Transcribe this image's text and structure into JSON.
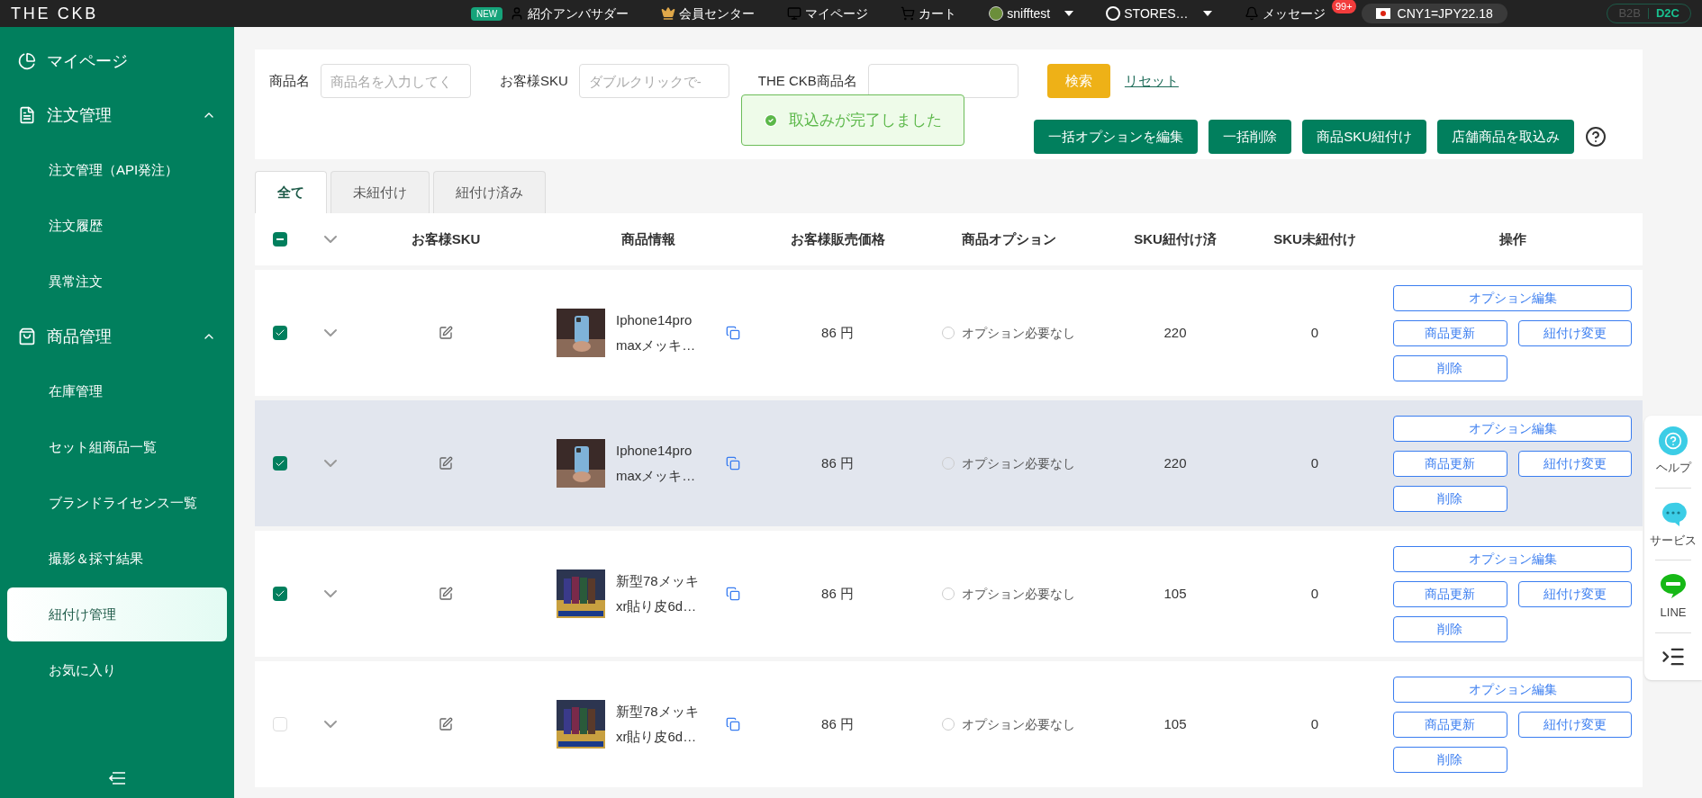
{
  "topbar": {
    "logo": "THE CKB",
    "links": [
      {
        "kind": "ambassador",
        "badge": "NEW",
        "label": "紹介アンバサダー"
      },
      {
        "kind": "member",
        "label": "会員センター"
      },
      {
        "kind": "mypage",
        "label": "マイページ"
      },
      {
        "kind": "cart",
        "label": "カート"
      },
      {
        "kind": "user",
        "label": "snifftest"
      },
      {
        "kind": "store",
        "label": "STORES…"
      },
      {
        "kind": "message",
        "label": "メッセージ",
        "badge": "99+"
      }
    ],
    "rate": "CNY1=JPY22.18",
    "modes": [
      {
        "label": "B2B",
        "selected": false
      },
      {
        "label": "D2C",
        "selected": true
      }
    ]
  },
  "sidebar": {
    "items": [
      {
        "kind": "home",
        "label": "マイページ"
      },
      {
        "kind": "orders",
        "label": "注文管理",
        "expanded": true,
        "children": [
          {
            "label": "注文管理（API発注）",
            "selected": false
          },
          {
            "label": "注文履歴",
            "selected": false
          },
          {
            "label": "異常注文",
            "selected": false
          }
        ]
      },
      {
        "kind": "products",
        "label": "商品管理",
        "expanded": true,
        "children": [
          {
            "label": "在庫管理",
            "selected": false
          },
          {
            "label": "セット組商品一覧",
            "selected": false
          },
          {
            "label": "ブランドライセンス一覧",
            "selected": false
          },
          {
            "label": "撮影＆採寸結果",
            "selected": false
          },
          {
            "label": "紐付け管理",
            "selected": true
          },
          {
            "label": "お気に入り",
            "selected": false
          }
        ]
      }
    ]
  },
  "filters": [
    {
      "label": "商品名",
      "placeholder": "商品名を入力してく"
    },
    {
      "label": "お客様SKU",
      "placeholder": "ダブルクリックで-"
    },
    {
      "label": "THE CKB商品名"
    }
  ],
  "search_button": "検索",
  "reset_link": "リセット",
  "toast": "取込みが完了しました",
  "actions": [
    "一括オプションを編集",
    "一括削除",
    "商品SKU紐付け",
    "店舗商品を取込み"
  ],
  "tabs": [
    {
      "label": "全て",
      "selected": true
    },
    {
      "label": "未紐付け",
      "selected": false
    },
    {
      "label": "紐付け済み",
      "selected": false
    }
  ],
  "table": {
    "indeterminate": true,
    "columns": [
      "お客様SKU",
      "商品情報",
      "お客様販売価格",
      "商品オプション",
      "SKU紐付け済",
      "SKU未紐付け",
      "操作"
    ],
    "rows": [
      {
        "checked": true,
        "hovered": false,
        "name": [
          "Iphone14pro",
          "maxメッキ…"
        ],
        "price": "86 円",
        "option": "オプション必要なし",
        "linked": "220",
        "unlinked": "0",
        "buttons": [
          "オプション編集",
          "商品更新",
          "紐付け変更",
          "削除"
        ]
      },
      {
        "checked": true,
        "hovered": true,
        "name": [
          "Iphone14pro",
          "maxメッキ…"
        ],
        "price": "86 円",
        "option": "オプション必要なし",
        "linked": "220",
        "unlinked": "0",
        "buttons": [
          "オプション編集",
          "商品更新",
          "紐付け変更",
          "削除"
        ]
      },
      {
        "checked": true,
        "hovered": false,
        "name": [
          "新型78メッキ",
          "xr貼り皮6d…"
        ],
        "price": "86 円",
        "option": "オプション必要なし",
        "linked": "105",
        "unlinked": "0",
        "buttons": [
          "オプション編集",
          "商品更新",
          "紐付け変更",
          "削除"
        ]
      },
      {
        "checked": false,
        "hovered": false,
        "name": [
          "新型78メッキ",
          "xr貼り皮6d…"
        ],
        "price": "86 円",
        "option": "オプション必要なし",
        "linked": "105",
        "unlinked": "0",
        "buttons": [
          "オプション編集",
          "商品更新",
          "紐付け変更",
          "削除"
        ]
      }
    ]
  },
  "float_panel": [
    {
      "kind": "help",
      "label": "ヘルプ"
    },
    {
      "kind": "service",
      "label": "サービス"
    },
    {
      "kind": "line",
      "label": "LINE"
    },
    {
      "kind": "menu"
    }
  ]
}
